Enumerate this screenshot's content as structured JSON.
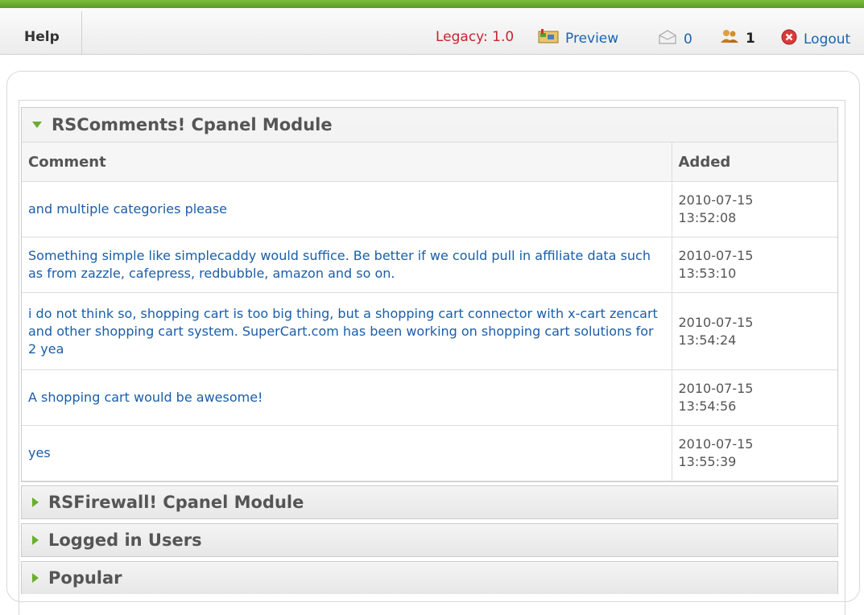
{
  "toolbar": {
    "help_label": "Help",
    "legacy_label": "Legacy: 1.0",
    "preview_label": "Preview",
    "messages_count": "0",
    "users_count": "1",
    "logout_label": "Logout"
  },
  "colors": {
    "accent_green": "#6aae2c",
    "link_blue": "#1a64b0",
    "legacy_red": "#c8242e"
  },
  "icons": [
    "preview-map-icon",
    "messages-icon",
    "users-icon",
    "logout-icon",
    "expand-arrow-icon",
    "collapse-arrow-icon"
  ],
  "modules": {
    "comments": {
      "title": "RSComments! Cpanel Module",
      "columns": {
        "comment": "Comment",
        "added": "Added"
      },
      "rows": [
        {
          "comment": "and multiple categories please",
          "date": "2010-07-15",
          "time": "13:52:08"
        },
        {
          "comment": "Something simple like simplecaddy would suffice. Be better if we could pull in affiliate data such as from zazzle, cafepress, redbubble, amazon and so on.",
          "date": "2010-07-15",
          "time": "13:53:10"
        },
        {
          "comment": "i do not think so, shopping cart is too big thing, but a shopping cart connector with x-cart zencart and other shopping cart system. SuperCart.com has been working on shopping cart solutions for 2 yea",
          "date": "2010-07-15",
          "time": "13:54:24"
        },
        {
          "comment": "A shopping cart would be awesome!",
          "date": "2010-07-15",
          "time": "13:54:56"
        },
        {
          "comment": "yes",
          "date": "2010-07-15",
          "time": "13:55:39"
        }
      ]
    },
    "firewall": {
      "title": "RSFirewall! Cpanel Module"
    },
    "logged_in": {
      "title": "Logged in Users"
    },
    "popular": {
      "title": "Popular"
    }
  }
}
